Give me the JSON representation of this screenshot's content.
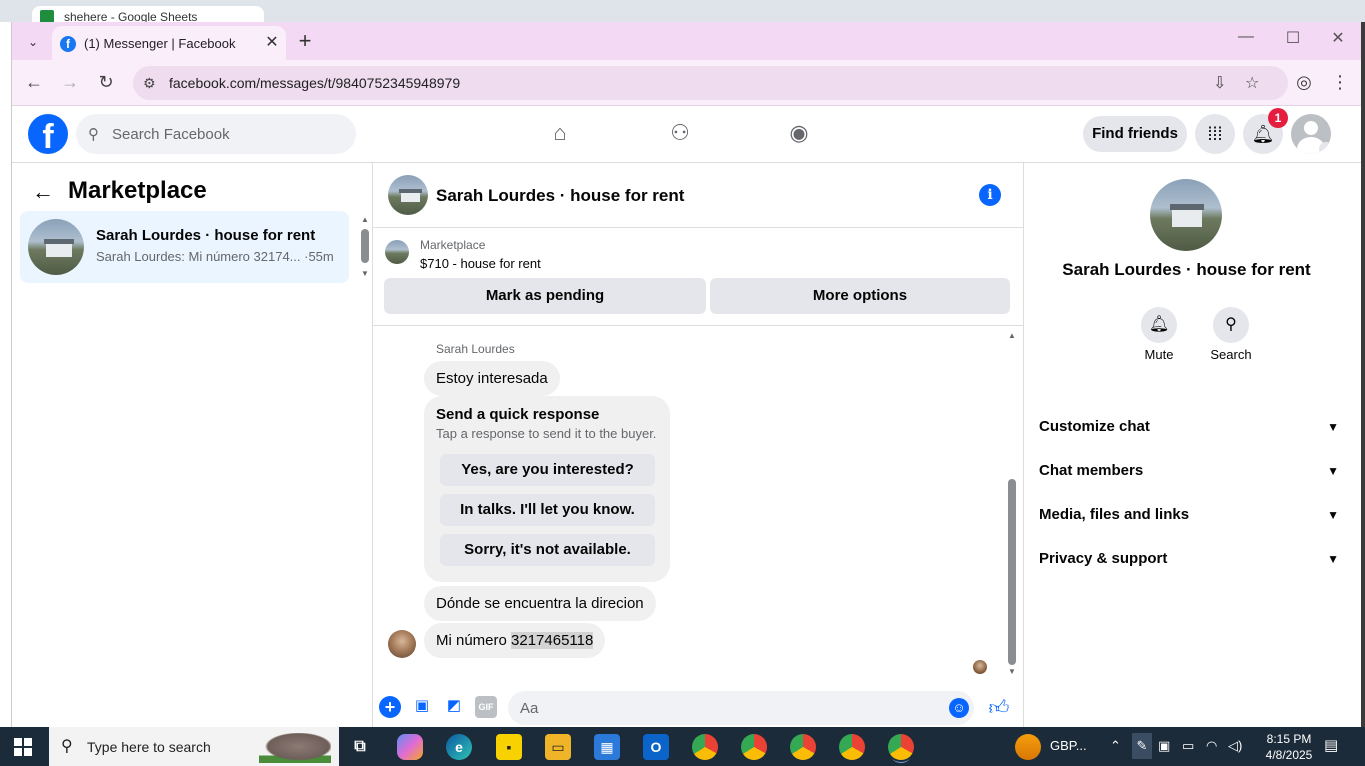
{
  "background": {
    "sheets_tab_title": "shehere - Google Sheets"
  },
  "browser": {
    "tab_title": "(1) Messenger | Facebook",
    "url": "facebook.com/messages/t/9840752345948979"
  },
  "fb": {
    "search_placeholder": "Search Facebook",
    "find_friends": "Find friends",
    "notification_count": "1"
  },
  "left_panel": {
    "title": "Marketplace",
    "conversation": {
      "name": "Sarah Lourdes · house for rent",
      "preview": "Sarah Lourdes: Mi número 32174... ·55m"
    }
  },
  "chat": {
    "header_name": "Sarah Lourdes · house for rent",
    "marketplace_label": "Marketplace",
    "listing": "$710 - house for rent",
    "mark_pending": "Mark as pending",
    "more_options": "More options",
    "sender_name": "Sarah Lourdes",
    "msg1": "Estoy interesada",
    "quick_title": "Send a quick response",
    "quick_subtitle": "Tap a response to send it to the buyer.",
    "quick_responses": [
      "Yes, are you interested?",
      "In talks. I'll let you know.",
      "Sorry, it's not available."
    ],
    "msg2": "Dónde se encuentra la direcion",
    "msg3_prefix": "Mi número ",
    "msg3_number": "3217465118",
    "composer_placeholder": "Aa"
  },
  "right_panel": {
    "name": "Sarah Lourdes · house for rent",
    "mute": "Mute",
    "search": "Search",
    "rows": [
      "Customize chat",
      "Chat members",
      "Media, files and links",
      "Privacy & support"
    ]
  },
  "taskbar": {
    "search_placeholder": "Type here to search",
    "currency": "GBP...",
    "time": "8:15 PM",
    "date": "4/8/2025"
  }
}
